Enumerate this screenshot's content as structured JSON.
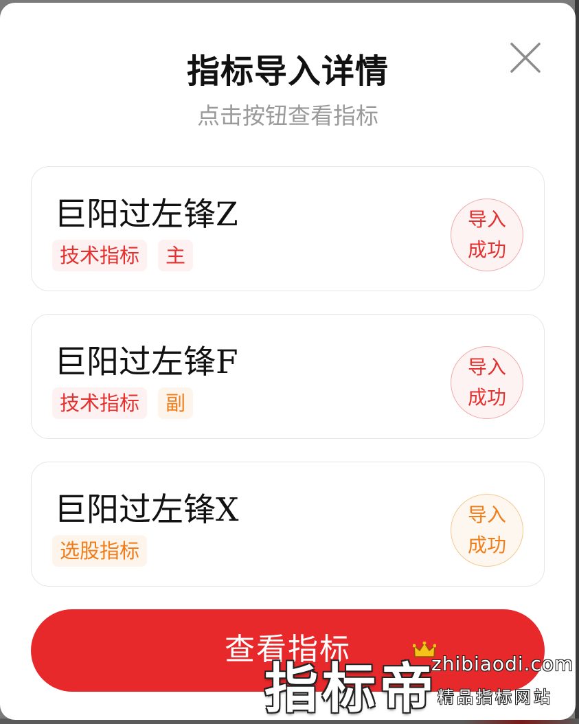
{
  "modal": {
    "title": "指标导入详情",
    "subtitle": "点击按钮查看指标",
    "close_icon": "close-icon"
  },
  "cards": [
    {
      "name": "巨阳过左锋Z",
      "tags": [
        {
          "label": "技术指标",
          "color": "#e3312f"
        },
        {
          "label": "主",
          "color": "#e3312f"
        }
      ],
      "status": {
        "line1": "导入",
        "line2": "成功",
        "color": "#e3312f"
      }
    },
    {
      "name": "巨阳过左锋F",
      "tags": [
        {
          "label": "技术指标",
          "color": "#e3312f"
        },
        {
          "label": "副",
          "color": "#f07d1a"
        }
      ],
      "status": {
        "line1": "导入",
        "line2": "成功",
        "color": "#e3312f"
      }
    },
    {
      "name": "巨阳过左锋X",
      "tags": [
        {
          "label": "选股指标",
          "color": "#f07d1a"
        }
      ],
      "status": {
        "line1": "导入",
        "line2": "成功",
        "color": "#f07d1a"
      }
    }
  ],
  "primary_button": {
    "label": "查看指标",
    "color": "#e8292b"
  },
  "watermark": {
    "brand": "指标帝",
    "domain": "zhibiaodi.com",
    "slogan": "精品指标网站",
    "icon": "crown-icon"
  }
}
